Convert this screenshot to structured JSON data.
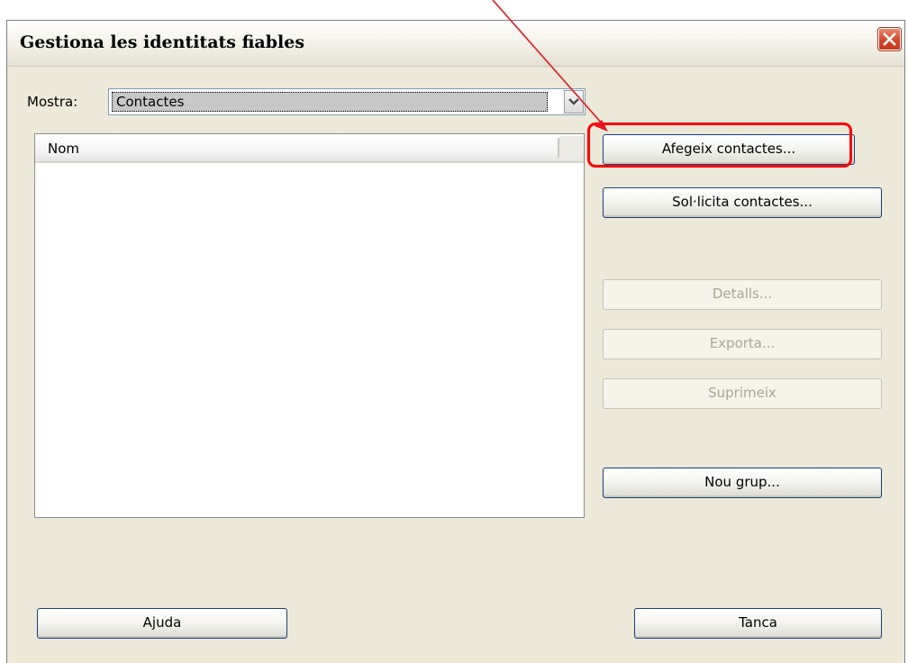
{
  "window": {
    "title": "Gestiona les identitats fiables",
    "close_icon": "close-icon"
  },
  "filter": {
    "label": "Mostra:",
    "selected": "Contactes"
  },
  "list": {
    "columns": [
      "Nom"
    ],
    "rows": []
  },
  "buttons": {
    "add_contacts": "Afegeix contactes...",
    "request_contacts": "Sol·licita contactes...",
    "details": "Detalls...",
    "export": "Exporta...",
    "delete": "Suprimeix",
    "new_group": "Nou grup...",
    "help": "Ajuda",
    "close": "Tanca"
  },
  "annotation": {
    "highlight_color": "#ff0000"
  }
}
